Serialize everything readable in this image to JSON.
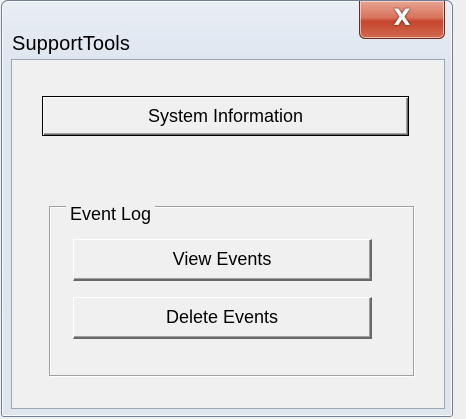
{
  "window": {
    "title": "SupportTools",
    "close_glyph": "X"
  },
  "buttons": {
    "system_info": "System Information",
    "view_events": "View Events",
    "delete_events": "Delete Events"
  },
  "event_log_group": {
    "label": "Event Log"
  },
  "icons": {
    "close": "close-icon"
  },
  "colors": {
    "close_button": "#c6452d",
    "dialog_background": "#f0f0f0",
    "frame": "#dfe6ef"
  }
}
